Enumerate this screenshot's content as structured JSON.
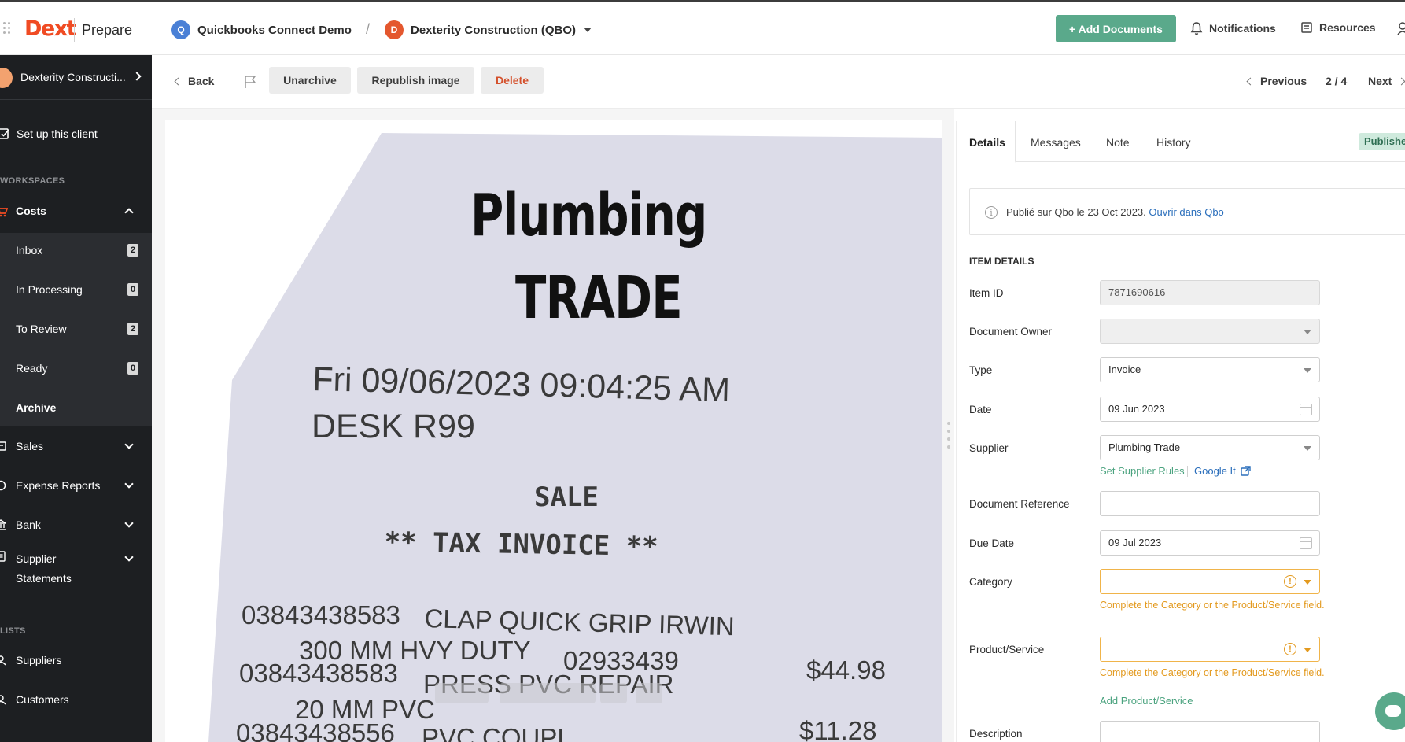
{
  "header": {
    "logo": "Dext",
    "product": "Prepare",
    "practice": {
      "initial": "Q",
      "name": "Quickbooks Connect Demo",
      "color": "#4a80d6"
    },
    "separator": "/",
    "client": {
      "initial": "D",
      "name": "Dexterity Construction (QBO)",
      "color": "#e4572e"
    },
    "add_documents": "+ Add Documents",
    "notifications": "Notifications",
    "resources": "Resources"
  },
  "sidebar": {
    "client_name": "Dexterity Constructi...",
    "setup": "Set up this client",
    "workspaces_label": "WORKSPACES",
    "costs": "Costs",
    "costs_items": [
      {
        "label": "Inbox",
        "count": "2"
      },
      {
        "label": "In Processing",
        "count": "0"
      },
      {
        "label": "To Review",
        "count": "2"
      },
      {
        "label": "Ready",
        "count": "0"
      },
      {
        "label": "Archive"
      }
    ],
    "sales": "Sales",
    "expense_reports": "Expense Reports",
    "bank": "Bank",
    "supplier_statements": "Supplier Statements",
    "lists_label": "LISTS",
    "suppliers": "Suppliers",
    "customers": "Customers"
  },
  "toolbar": {
    "back": "Back",
    "unarchive": "Unarchive",
    "republish": "Republish image",
    "delete": "Delete",
    "previous": "Previous",
    "position": "2 / 4",
    "next": "Next"
  },
  "receipt": {
    "line1": "Plumbing",
    "line2": "TRADE",
    "datetime": "Fri 09/06/2023 09:04:25 AM",
    "desk": "DESK R99",
    "sale": "SALE",
    "tax_invoice": "** TAX INVOICE **",
    "item1_code": "03843438583",
    "item1_desc": "CLAP QUICK GRIP IRWIN",
    "item1_desc2": "300 MM HVY DUTY",
    "item1_sku": "02933439",
    "item1_price": "$44.98",
    "item2_code": "03843438583",
    "item2_desc": "PRESS PVC REPAIR",
    "item2_desc2": "20 MM PVC",
    "item3_code": "03843438556",
    "item3_desc": "PVC COUPL",
    "item3_price": "$11.28"
  },
  "panel": {
    "tabs": [
      "Details",
      "Messages",
      "Note",
      "History"
    ],
    "status": "Published",
    "info_text": "Publié sur Qbo le 23 Oct 2023.",
    "info_link": "Ouvrir dans Qbo",
    "section": "ITEM DETAILS",
    "item_id_label": "Item ID",
    "item_id": "7871690616",
    "owner_label": "Document Owner",
    "owner": "",
    "type_label": "Type",
    "type": "Invoice",
    "date_label": "Date",
    "date": "09 Jun 2023",
    "supplier_label": "Supplier",
    "supplier": "Plumbing Trade",
    "supplier_rules": "Set Supplier Rules",
    "google_it": "Google It",
    "doc_ref_label": "Document Reference",
    "doc_ref": "",
    "due_date_label": "Due Date",
    "due_date": "09 Jul 2023",
    "category_label": "Category",
    "category_warning": "Complete the Category or the Product/Service field.",
    "product_label": "Product/Service",
    "product_warning": "Complete the Category or the Product/Service field.",
    "add_product": "Add Product/Service",
    "description_label": "Description"
  },
  "colors": {
    "brand": "#f04b23",
    "primary": "#5aa98b",
    "warning": "#e39a1f",
    "link": "#2a6ebb",
    "sidebar": "#1d1f22"
  }
}
